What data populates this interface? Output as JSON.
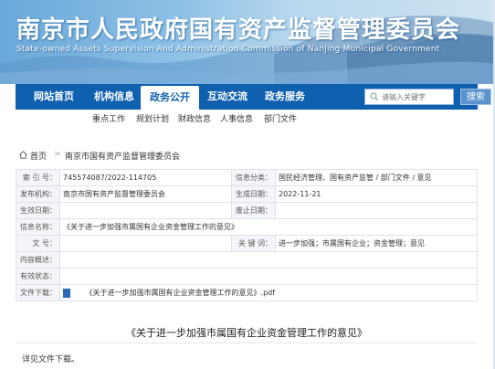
{
  "site": {
    "title": "南京市人民政府国有资产监督管理委员会",
    "subtitle": "State-owned Assets Supervision And Administration Commission of Nanjing Municipal Government"
  },
  "nav": {
    "items": [
      "网站首页",
      "机构信息",
      "政务公开",
      "互动交流",
      "政务服务"
    ],
    "active_index": 2,
    "search_placeholder": "请输入关键字",
    "search_button": "搜索"
  },
  "subnav": {
    "items": [
      "重点工作",
      "规划计划",
      "财政信息",
      "人事信息",
      "部门文件"
    ]
  },
  "breadcrumb": {
    "home": "首页",
    "separator": ">",
    "current": "南京市国有资产监督管理委员会"
  },
  "info": {
    "index_no_label": "索 引 号：",
    "index_no": "745574087/2022-114705",
    "category_label": "信息分类：",
    "category": "国民经济管理、国有资产监管 / 部门文件 / 意见",
    "issuer_label": "发布机构：",
    "issuer": "南京市国有资产监督管理委员会",
    "date_label": "生成日期：",
    "date": "2022-11-21",
    "effective_label": "生效日期：",
    "effective": "",
    "expire_label": "废止日期：",
    "expire": "",
    "name_label": "信息名称：",
    "name": "《关于进一步加强市属国有企业资金管理工作的意见》",
    "doc_no_label": "文 号：",
    "doc_no": "",
    "keywords_label": "关 键 词：",
    "keywords": "进一步加强；市属国有企业；资金管理；意见",
    "content_summary_label": "内容概述：",
    "content_summary": "",
    "status_label": "有效状态：",
    "status": "",
    "attachment_label": "文件下载：",
    "attachment": "《关于进一步加强市属国有企业资金管理工作的意见》.pdf"
  },
  "article": {
    "title": "《关于进一步加强市属国有企业资金管理工作的意见》",
    "text": "详见文件下载。"
  },
  "colors": {
    "nav_bg": "#1060b0",
    "accent": "#1060b0"
  }
}
